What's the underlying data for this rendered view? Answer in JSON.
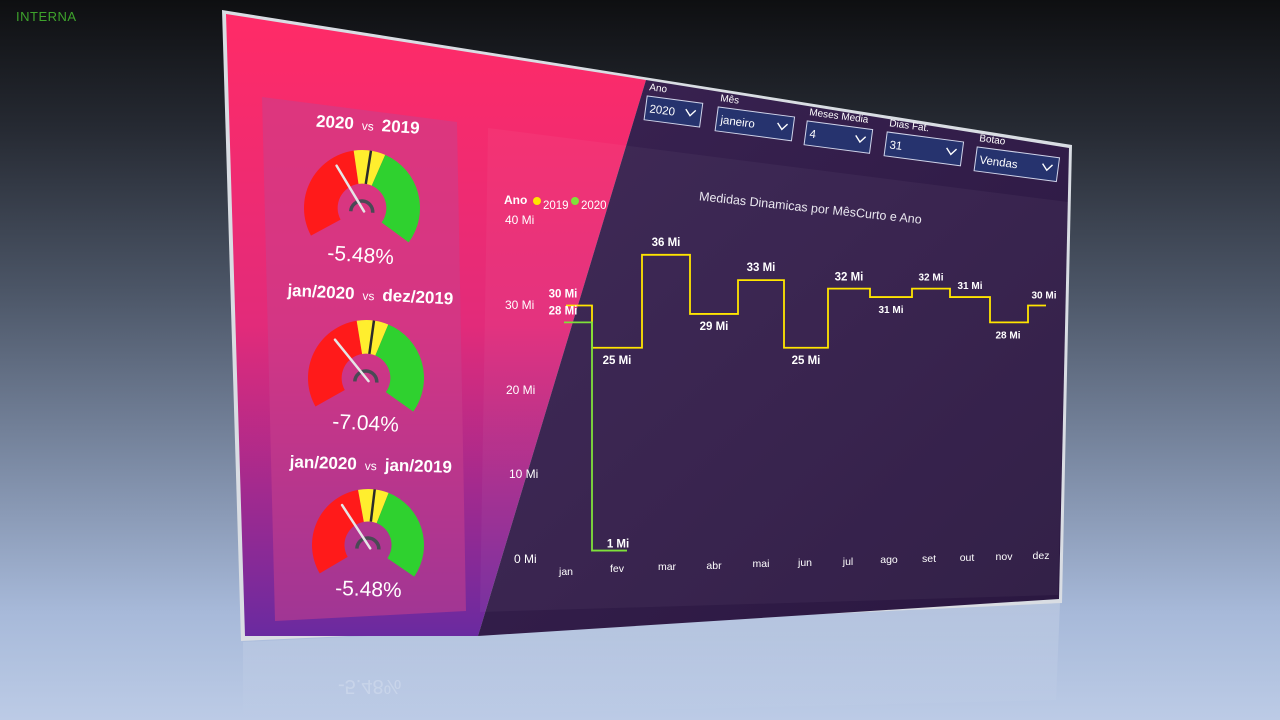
{
  "corner_label": "INTERNA",
  "colors": {
    "pink": "#ff2d6b",
    "purple_dark": "#2f1a46",
    "gauge_red": "#ff1a1a",
    "gauge_yellow": "#ffee2e",
    "gauge_green": "#2fd12f",
    "line_2019": "#ffe500",
    "line_2020": "#7fe13a"
  },
  "gauges": [
    {
      "title_left": "2020",
      "vs": "vs",
      "title_right": "2019",
      "value": "-5.48%"
    },
    {
      "title_left": "jan/2020",
      "vs": "vs",
      "title_right": "dez/2019",
      "value": "-7.04%"
    },
    {
      "title_left": "jan/2020",
      "vs": "vs",
      "title_right": "jan/2019",
      "value": "-5.48%"
    }
  ],
  "filters": [
    {
      "label": "Ano",
      "value": "2020"
    },
    {
      "label": "Mês",
      "value": "janeiro"
    },
    {
      "label": "Meses Media",
      "value": "4"
    },
    {
      "label": "Dias Fat.",
      "value": "31"
    },
    {
      "label": "Botao",
      "value": "Vendas"
    }
  ],
  "chart_data": {
    "type": "line",
    "title": "Medidas Dinamicas por MêsCurto e Ano",
    "legend_title": "Ano",
    "legend_position": "top-left",
    "categories": [
      "jan",
      "fev",
      "mar",
      "abr",
      "mai",
      "jun",
      "jul",
      "ago",
      "set",
      "out",
      "nov",
      "dez"
    ],
    "y_ticks": [
      "0 Mi",
      "10 Mi",
      "20 Mi",
      "30 Mi",
      "40 Mi"
    ],
    "ylim": [
      0,
      40
    ],
    "step": true,
    "grid": false,
    "series": [
      {
        "name": "2019",
        "values": [
          30,
          25,
          36,
          29,
          33,
          25,
          32,
          31,
          32,
          31,
          28,
          30
        ],
        "labels": [
          "30 Mi",
          "25 Mi",
          "36 Mi",
          "29 Mi",
          "33 Mi",
          "25 Mi",
          "32 Mi",
          "31 Mi",
          "32 Mi",
          "31 Mi",
          "28 Mi",
          "30 Mi"
        ]
      },
      {
        "name": "2020",
        "values": [
          28,
          1
        ],
        "labels": [
          "28 Mi",
          "1 Mi"
        ]
      }
    ]
  }
}
